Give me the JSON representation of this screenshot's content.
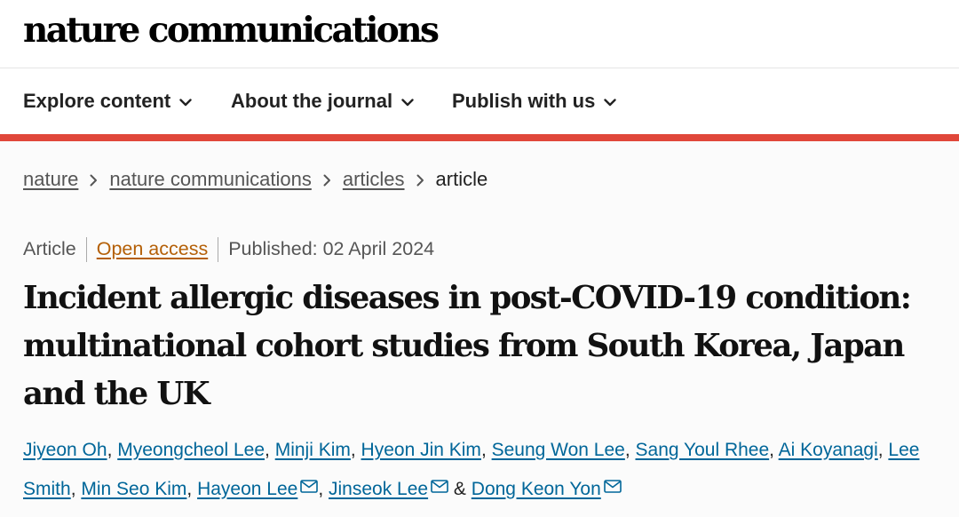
{
  "header": {
    "logo": "nature communications"
  },
  "nav": {
    "items": [
      {
        "label": "Explore content"
      },
      {
        "label": "About the journal"
      },
      {
        "label": "Publish with us"
      }
    ]
  },
  "breadcrumb": {
    "links": [
      "nature",
      "nature communications",
      "articles"
    ],
    "current": "article"
  },
  "article": {
    "type": "Article",
    "access": "Open access",
    "published": "Published: 02 April 2024",
    "title": "Incident allergic diseases in post-COVID-19 condition: multinational cohort studies from South Korea, Japan and the UK",
    "authors": [
      "Jiyeon Oh",
      "Myeongcheol Lee",
      "Minji Kim",
      "Hyeon Jin Kim",
      "Seung Won Lee",
      "Sang Youl Rhee",
      "Ai Koyanagi",
      "Lee Smith",
      "Min Seo Kim",
      "Hayeon Lee",
      "Jinseok Lee",
      "Dong Keon Yon"
    ],
    "author_separator": ",",
    "author_conjunction": "&"
  },
  "colors": {
    "accent_rule": "#e0473a",
    "author_link": "#006699",
    "open_access": "#b45f06"
  },
  "icons": {
    "nav_chevron": "chevron-down-icon",
    "breadcrumb_separator": "chevron-right-icon",
    "corresponding_author": "mail-icon"
  }
}
